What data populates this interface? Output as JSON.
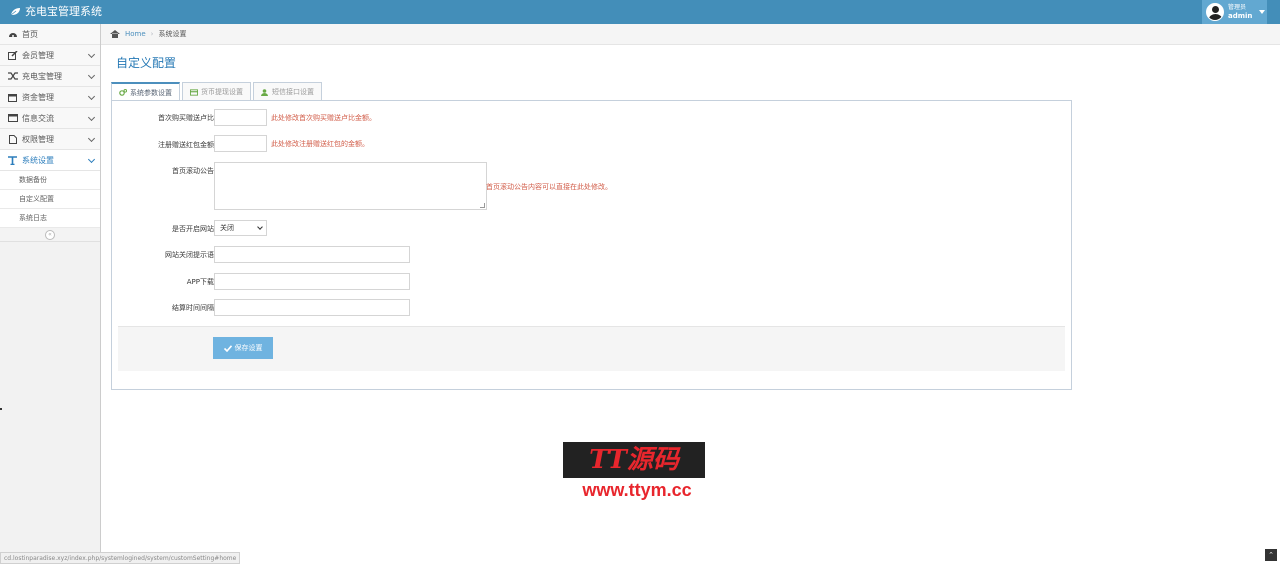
{
  "app": {
    "title": "充电宝管理系统"
  },
  "user": {
    "role": "管理员",
    "name": "admin"
  },
  "sidebar": {
    "items": [
      {
        "label": "首页",
        "icon": "dashboard-icon"
      },
      {
        "label": "会员管理",
        "icon": "edit-icon"
      },
      {
        "label": "充电宝管理",
        "icon": "random-icon"
      },
      {
        "label": "资金管理",
        "icon": "calendar-icon"
      },
      {
        "label": "信息交流",
        "icon": "list-icon"
      },
      {
        "label": "权限管理",
        "icon": "file-icon"
      },
      {
        "label": "系统设置",
        "icon": "text-icon"
      }
    ],
    "subitems": [
      {
        "label": "数据备份"
      },
      {
        "label": "自定义配置"
      },
      {
        "label": "系统日志"
      }
    ]
  },
  "breadcrumb": {
    "home": "Home",
    "current": "系统设置"
  },
  "page": {
    "title": "自定义配置"
  },
  "tabs": [
    {
      "label": "系统参数设置",
      "icon": "cogs-icon"
    },
    {
      "label": "货币提现设置",
      "icon": "credit-card-icon"
    },
    {
      "label": "短信接口设置",
      "icon": "user-icon"
    }
  ],
  "form": {
    "purchase_ratio": {
      "label": "首次购买赠送卢比",
      "value": "",
      "hint": "此处修改首次购买赠送卢比金额。"
    },
    "register_bonus": {
      "label": "注册赠送红包金额",
      "value": "",
      "hint": "此处修改注册赠送红包的金额。"
    },
    "announcement": {
      "label": "首页滚动公告",
      "value": "",
      "hint": "首页滚动公告内容可以直接在此处修改。"
    },
    "site_open": {
      "label": "是否开启网站",
      "value": "关闭"
    },
    "close_message": {
      "label": "网站关闭提示语",
      "value": ""
    },
    "app_download": {
      "label": "APP下载",
      "value": ""
    },
    "settle_interval": {
      "label": "结算时间间隔",
      "value": ""
    },
    "save_label": "保存设置"
  },
  "watermark": {
    "title": "TT源码",
    "url": "www.ttym.cc"
  },
  "status": {
    "url": "cd.lostinparadise.xyz/index.php/systemlogined/system/customSetting#home"
  },
  "colors": {
    "navbar": "#438eb9",
    "accent": "#2679b5",
    "hint": "#d15b47",
    "button": "#6fb3e0"
  }
}
